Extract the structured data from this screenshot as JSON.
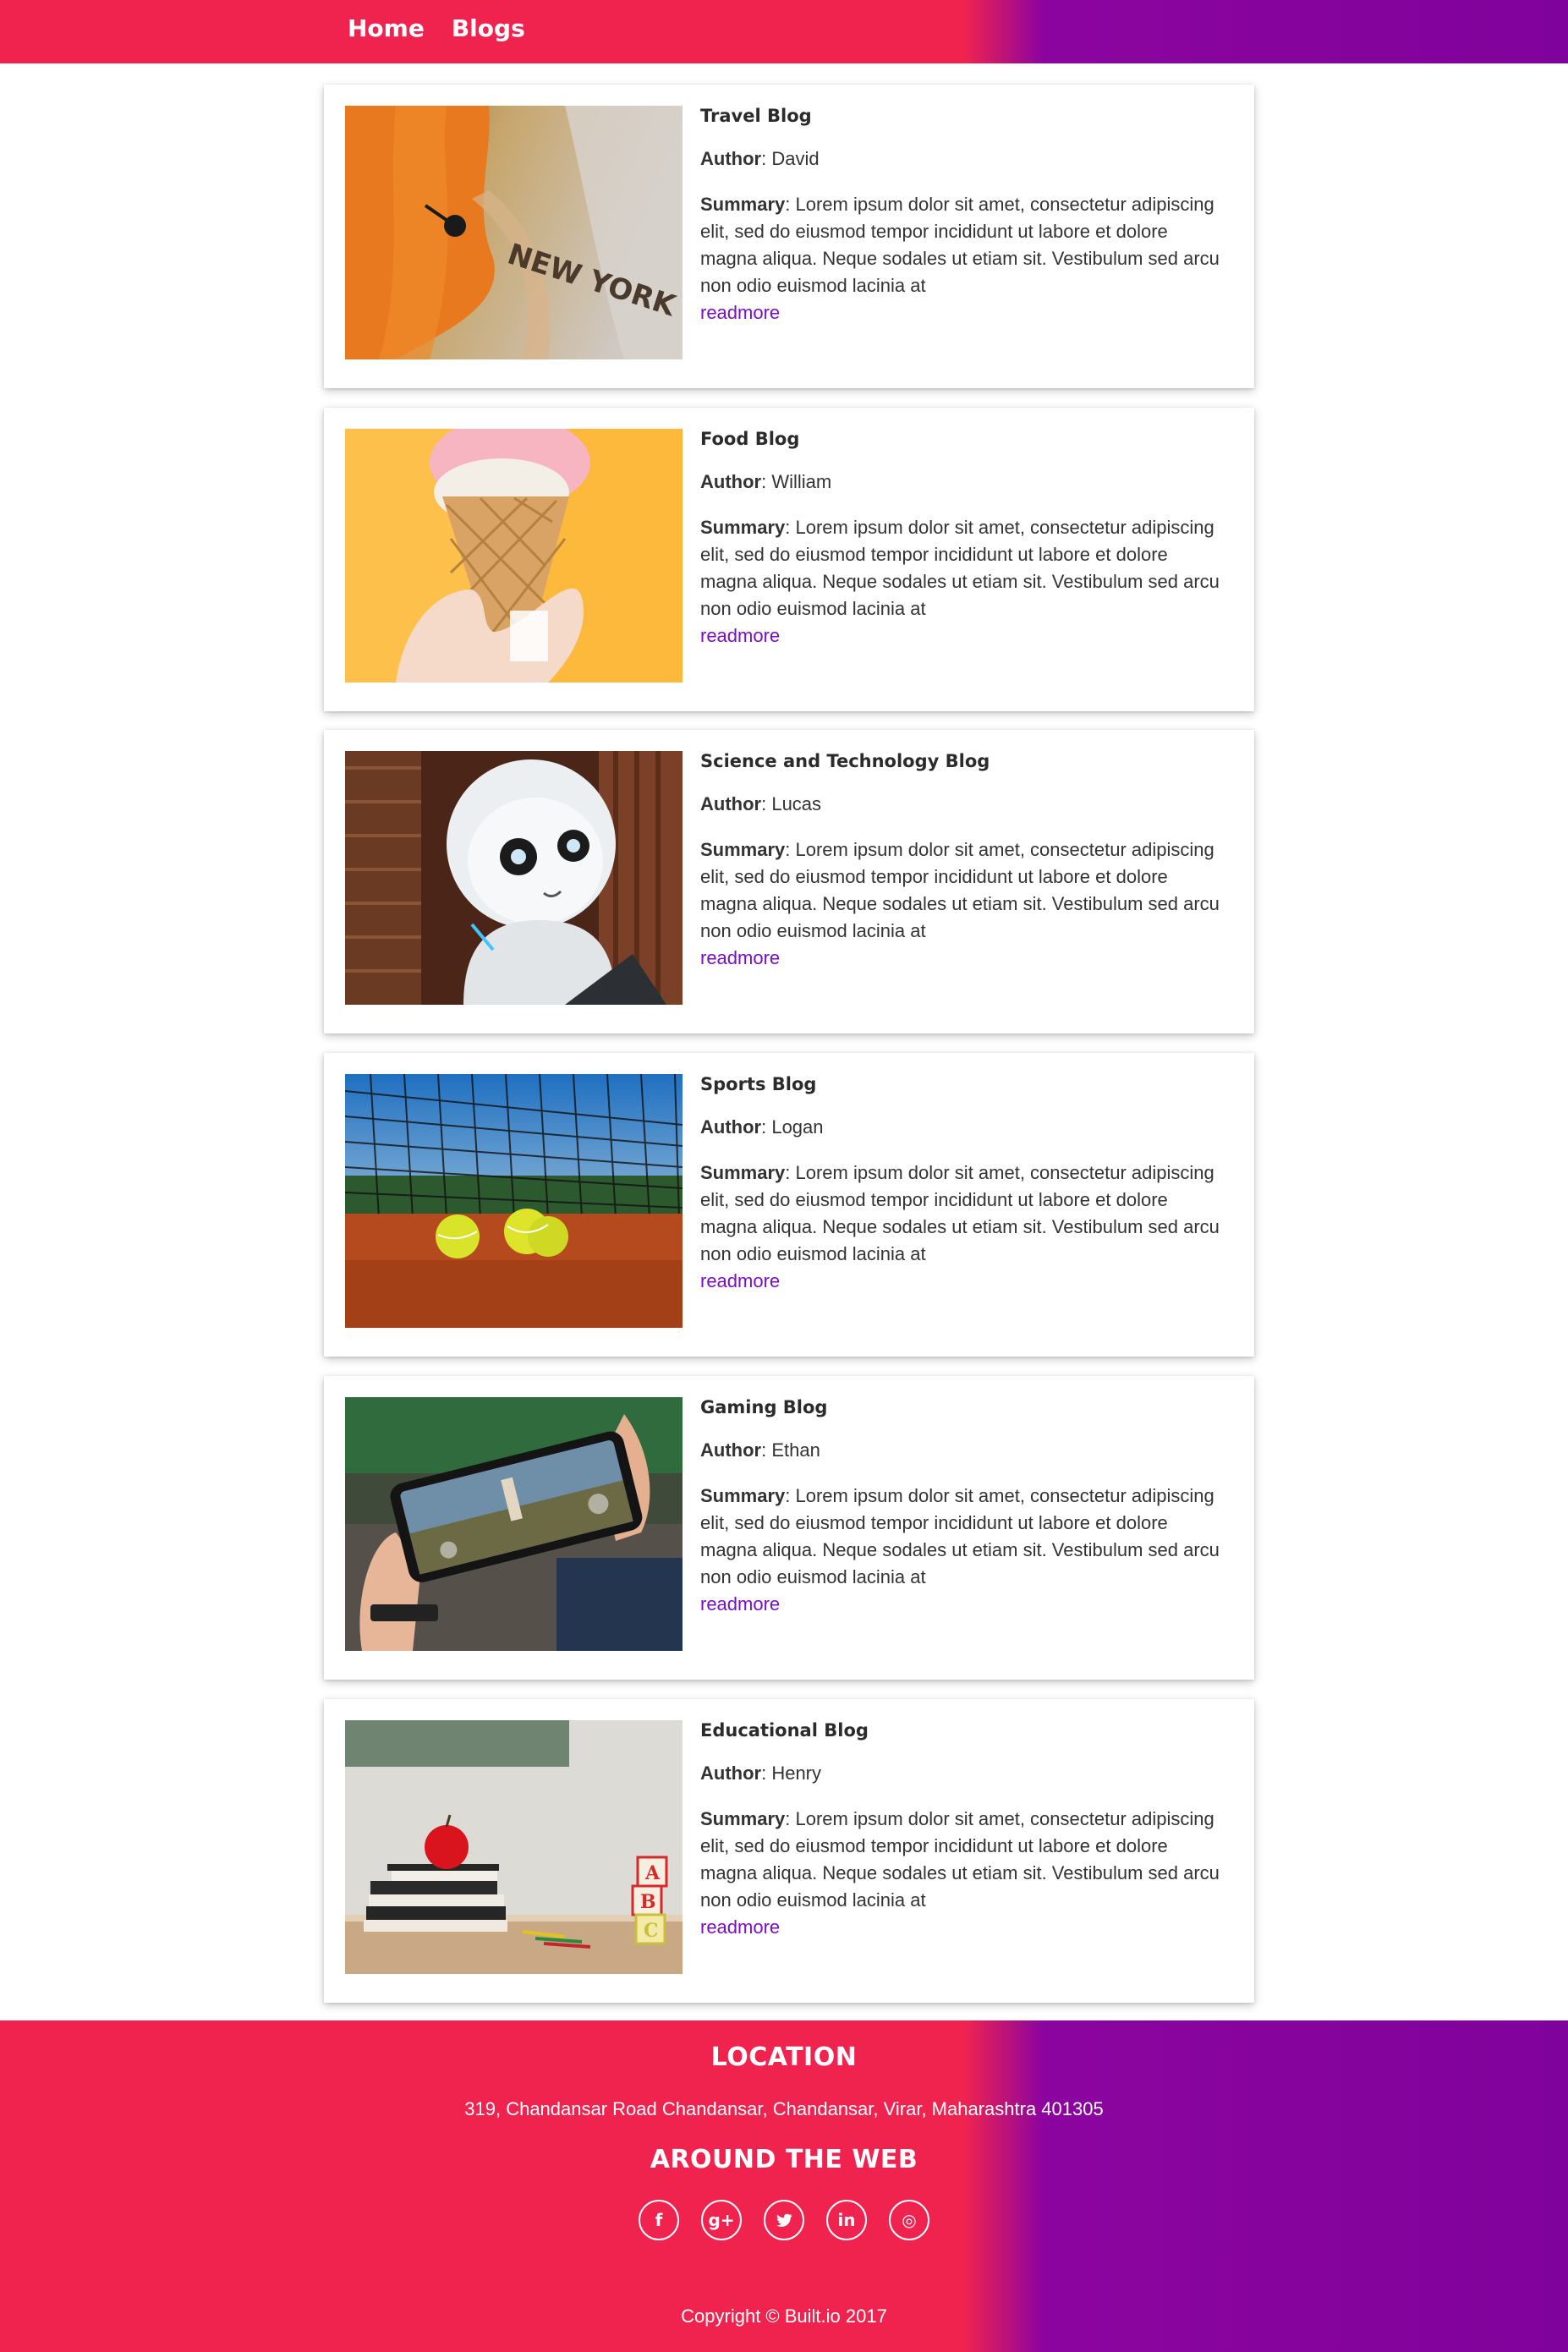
{
  "nav": {
    "items": [
      "Home",
      "Blogs"
    ]
  },
  "labels": {
    "author": "Author",
    "summary": "Summary",
    "readmore": "readmore"
  },
  "posts": [
    {
      "title": "Travel Blog",
      "author": "David",
      "summary": ": Lorem ipsum dolor sit amet, consectetur adipiscing elit, sed do eiusmod tempor incididunt ut labore et dolore magna aliqua. Neque sodales ut etiam sit. Vestibulum sed arcu non odio euismod lacinia at"
    },
    {
      "title": "Food Blog",
      "author": "William",
      "summary": ": Lorem ipsum dolor sit amet, consectetur adipiscing elit, sed do eiusmod tempor incididunt ut labore et dolore magna aliqua. Neque sodales ut etiam sit. Vestibulum sed arcu non odio euismod lacinia at"
    },
    {
      "title": "Science and Technology Blog",
      "author": "Lucas",
      "summary": ": Lorem ipsum dolor sit amet, consectetur adipiscing elit, sed do eiusmod tempor incididunt ut labore et dolore magna aliqua. Neque sodales ut etiam sit. Vestibulum sed arcu non odio euismod lacinia at"
    },
    {
      "title": "Sports Blog",
      "author": "Logan",
      "summary": ": Lorem ipsum dolor sit amet, consectetur adipiscing elit, sed do eiusmod tempor incididunt ut labore et dolore magna aliqua. Neque sodales ut etiam sit. Vestibulum sed arcu non odio euismod lacinia at"
    },
    {
      "title": "Gaming Blog",
      "author": "Ethan",
      "summary": ": Lorem ipsum dolor sit amet, consectetur adipiscing elit, sed do eiusmod tempor incididunt ut labore et dolore magna aliqua. Neque sodales ut etiam sit. Vestibulum sed arcu non odio euismod lacinia at"
    },
    {
      "title": "Educational Blog",
      "author": "Henry",
      "summary": ": Lorem ipsum dolor sit amet, consectetur adipiscing elit, sed do eiusmod tempor incididunt ut labore et dolore magna aliqua. Neque sodales ut etiam sit. Vestibulum sed arcu non odio euismod lacinia at"
    }
  ],
  "map_label": "NEW YORK",
  "footer": {
    "location_title": "LOCATION",
    "address": "319, Chandansar Road Chandansar, Chandansar, Virar, Maharashtra 401305",
    "web_title": "AROUND THE WEB",
    "social": [
      {
        "icon": "facebook-icon",
        "glyph": "f"
      },
      {
        "icon": "google-plus-icon",
        "glyph": "g+"
      },
      {
        "icon": "twitter-icon",
        "glyph": "t"
      },
      {
        "icon": "linkedin-icon",
        "glyph": "in"
      },
      {
        "icon": "dribbble-icon",
        "glyph": "◎"
      }
    ],
    "copyright": "Copyright © Built.io 2017"
  },
  "colors": {
    "brand_pink": "#f0234f",
    "brand_purple": "#80029c",
    "link": "#7a0ec2"
  }
}
